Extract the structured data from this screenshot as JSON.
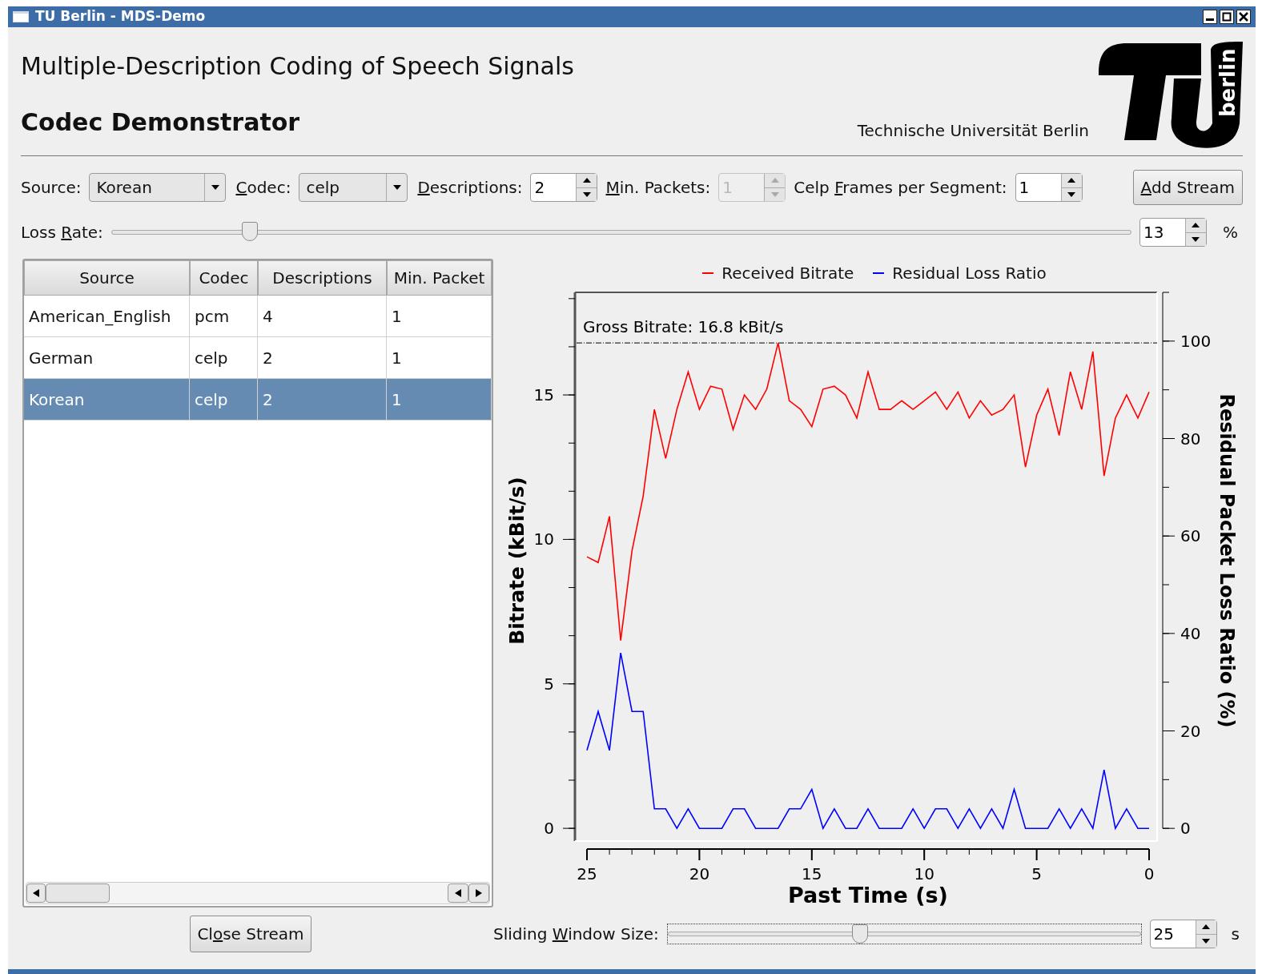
{
  "window": {
    "title": "TU Berlin - MDS-Demo"
  },
  "header": {
    "title": "Multiple-Description Coding of Speech Signals",
    "subtitle": "Codec Demonstrator",
    "institution": "Technische Universität Berlin",
    "logo_text": "berlin"
  },
  "controls": [
    {
      "kind": "combo",
      "label": "Source:",
      "value": "Korean"
    },
    {
      "kind": "combo",
      "label": {
        "key": "C",
        "post": "odec:"
      },
      "value": "celp"
    },
    {
      "kind": "spin",
      "label": {
        "key": "D",
        "post": "escriptions:"
      },
      "value": "2",
      "disabled": false
    },
    {
      "kind": "spin",
      "label": {
        "key": "M",
        "post": "in. Packets:"
      },
      "value": "1",
      "disabled": true
    },
    {
      "kind": "spin",
      "label": {
        "pre": "Celp ",
        "key": "F",
        "post": "rames per Segment:"
      },
      "value": "1",
      "disabled": false
    },
    {
      "kind": "button",
      "label": {
        "key": "A",
        "post": "dd Stream"
      }
    }
  ],
  "loss_rate": {
    "label": {
      "pre": "Loss ",
      "key": "R",
      "post": "ate:"
    },
    "level": 0.136,
    "value": "13",
    "unit": "%"
  },
  "table": {
    "columns": [
      "Source",
      "Codec",
      "Descriptions",
      "Min. Packet"
    ],
    "rows": [
      {
        "cells": [
          "American_English",
          "pcm",
          "4",
          "1"
        ],
        "selected": false
      },
      {
        "cells": [
          "German",
          "celp",
          "2",
          "1"
        ],
        "selected": false
      },
      {
        "cells": [
          "Korean",
          "celp",
          "2",
          "1"
        ],
        "selected": true
      }
    ]
  },
  "close_button": {
    "label": {
      "pre": "Cl",
      "key": "o",
      "post": "se Stream"
    }
  },
  "chart": {
    "chart_data": {
      "type": "line",
      "xlabel": "Past Time (s)",
      "ylabel": "Bitrate (kBit/s)",
      "y2label": "Residual Packet Loss Ratio (%)",
      "x": [
        25,
        24.5,
        24,
        23.5,
        23,
        22.5,
        22,
        21.5,
        21,
        20.5,
        20,
        19.5,
        19,
        18.5,
        18,
        17.5,
        17,
        16.5,
        16,
        15.5,
        15,
        14.5,
        14,
        13.5,
        13,
        12.5,
        12,
        11.5,
        11,
        10.5,
        10,
        9.5,
        9,
        8.5,
        8,
        7.5,
        7,
        6.5,
        6,
        5.5,
        5,
        4.5,
        4,
        3.5,
        3,
        2.5,
        2,
        1.5,
        1,
        0.5,
        0
      ],
      "xlim": [
        25,
        0
      ],
      "ylim": [
        -0.44,
        18.55
      ],
      "y2lim": [
        -2.6,
        110
      ],
      "xticks": [
        25,
        20,
        15,
        10,
        5,
        0
      ],
      "yticks": [
        0,
        5,
        10,
        15
      ],
      "y2ticks": [
        0,
        20,
        40,
        60,
        80,
        100
      ],
      "series": [
        {
          "name": "Received Bitrate",
          "color": "#ff0000",
          "values": [
            9.4,
            9.2,
            10.8,
            6.5,
            9.6,
            11.5,
            14.5,
            12.8,
            14.5,
            15.8,
            14.5,
            15.3,
            15.2,
            13.8,
            15.0,
            14.5,
            15.2,
            16.8,
            14.8,
            14.5,
            13.9,
            15.2,
            15.3,
            15.0,
            14.2,
            15.8,
            14.5,
            14.5,
            14.8,
            14.5,
            14.8,
            15.1,
            14.5,
            15.1,
            14.2,
            14.8,
            14.3,
            14.5,
            15.0,
            12.5,
            14.3,
            15.2,
            13.6,
            15.8,
            14.5,
            16.5,
            12.2,
            14.2,
            15.0,
            14.2,
            15.1
          ]
        },
        {
          "name": "Residual Loss Ratio",
          "color": "#0000ff",
          "axis": "y2",
          "values": [
            16,
            24,
            16,
            36,
            24,
            24,
            4,
            4,
            0,
            4,
            0,
            0,
            0,
            4,
            4,
            0,
            0,
            0,
            4,
            4,
            8,
            0,
            4,
            0,
            0,
            4,
            0,
            0,
            0,
            4,
            0,
            4,
            4,
            0,
            4,
            0,
            4,
            0,
            8,
            0,
            0,
            0,
            4,
            0,
            4,
            0,
            12,
            0,
            4,
            0,
            0
          ]
        }
      ],
      "annotations": [
        "Gross Bitrate: 16.8 kBit/s"
      ]
    }
  },
  "sliding_window": {
    "label": {
      "pre": "Sliding ",
      "key": "W",
      "post": "indow Size:"
    },
    "level": 0.407,
    "value": "25",
    "unit": "s"
  }
}
